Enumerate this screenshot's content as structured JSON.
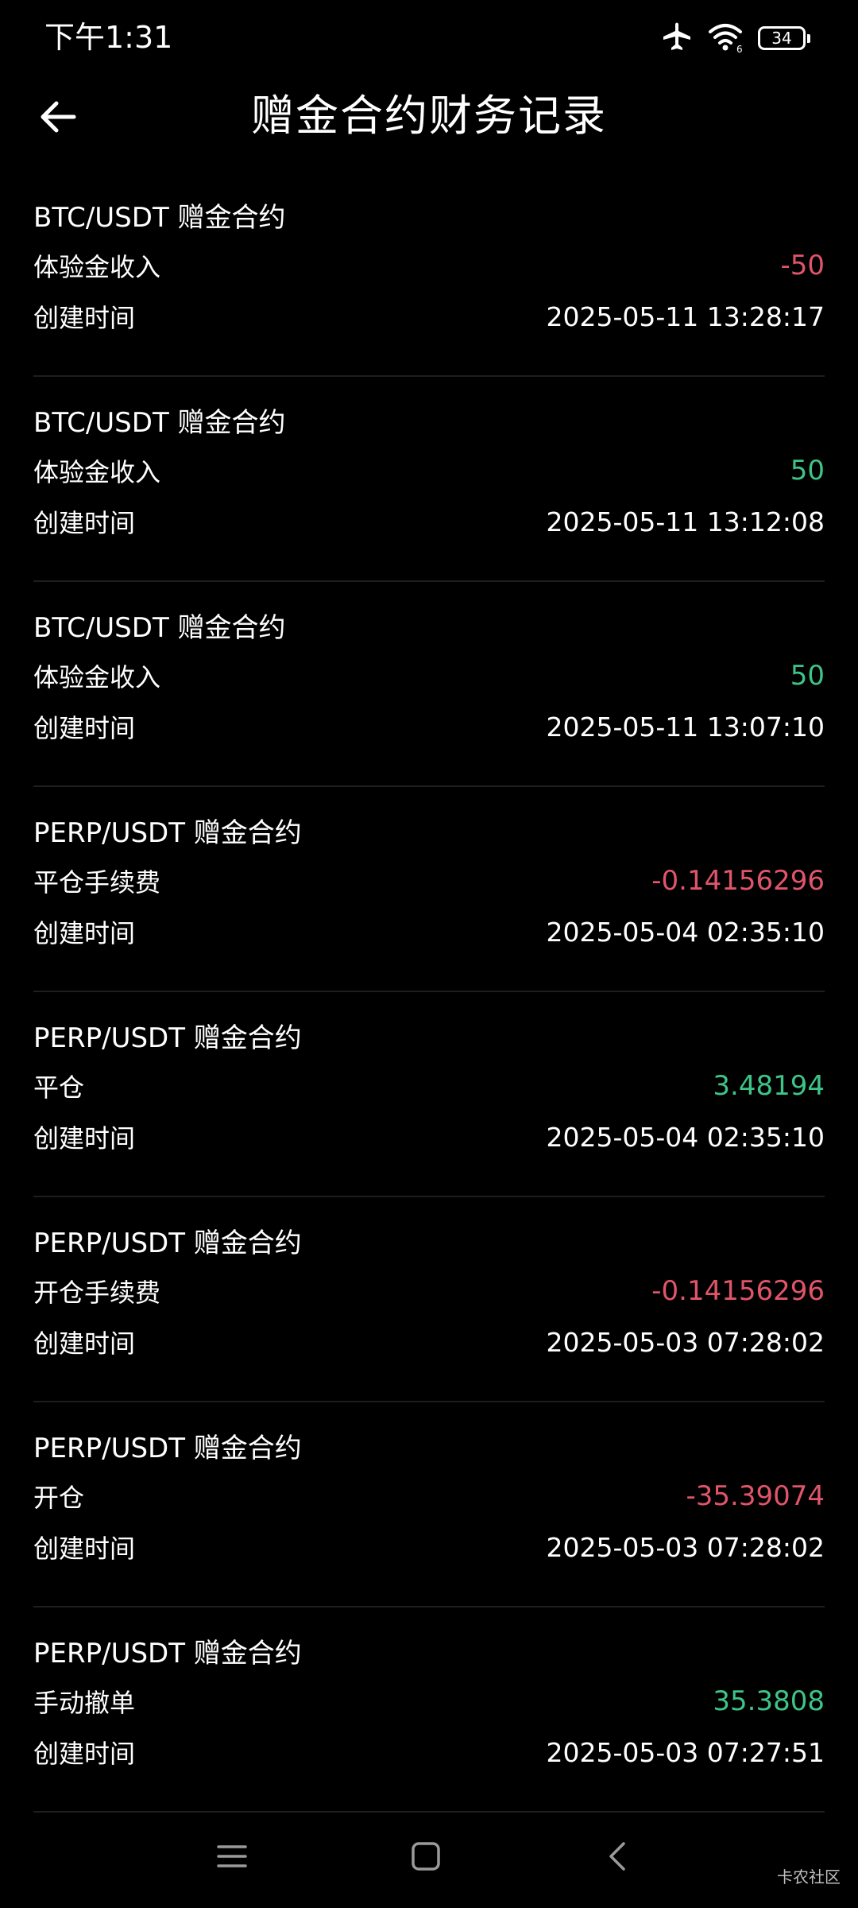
{
  "status_bar": {
    "time": "下午1:31",
    "battery": "34",
    "icons": [
      "airplane-icon",
      "wifi-icon",
      "battery-icon"
    ]
  },
  "header": {
    "title": "赠金合约财务记录",
    "back_icon": "arrow-left-icon"
  },
  "time_label": "创建时间",
  "records": [
    {
      "pair": "BTC/USDT 赠金合约",
      "type": "体验金收入",
      "amount": "-50",
      "time": "2025-05-11 13:28:17"
    },
    {
      "pair": "BTC/USDT 赠金合约",
      "type": "体验金收入",
      "amount": "50",
      "time": "2025-05-11 13:12:08"
    },
    {
      "pair": "BTC/USDT 赠金合约",
      "type": "体验金收入",
      "amount": "50",
      "time": "2025-05-11 13:07:10"
    },
    {
      "pair": "PERP/USDT 赠金合约",
      "type": "平仓手续费",
      "amount": "-0.14156296",
      "time": "2025-05-04 02:35:10"
    },
    {
      "pair": "PERP/USDT 赠金合约",
      "type": "平仓",
      "amount": "3.48194",
      "time": "2025-05-04 02:35:10"
    },
    {
      "pair": "PERP/USDT 赠金合约",
      "type": "开仓手续费",
      "amount": "-0.14156296",
      "time": "2025-05-03 07:28:02"
    },
    {
      "pair": "PERP/USDT 赠金合约",
      "type": "开仓",
      "amount": "-35.39074",
      "time": "2025-05-03 07:28:02"
    },
    {
      "pair": "PERP/USDT 赠金合约",
      "type": "手动撤单",
      "amount": "35.3808",
      "time": "2025-05-03 07:27:51"
    }
  ],
  "colors": {
    "negative": "#e0556a",
    "positive": "#3ec487",
    "background": "#000000"
  },
  "nav_bar": {
    "icons": [
      "menu-icon",
      "home-icon",
      "back-icon"
    ]
  },
  "watermark": "卡农社区"
}
